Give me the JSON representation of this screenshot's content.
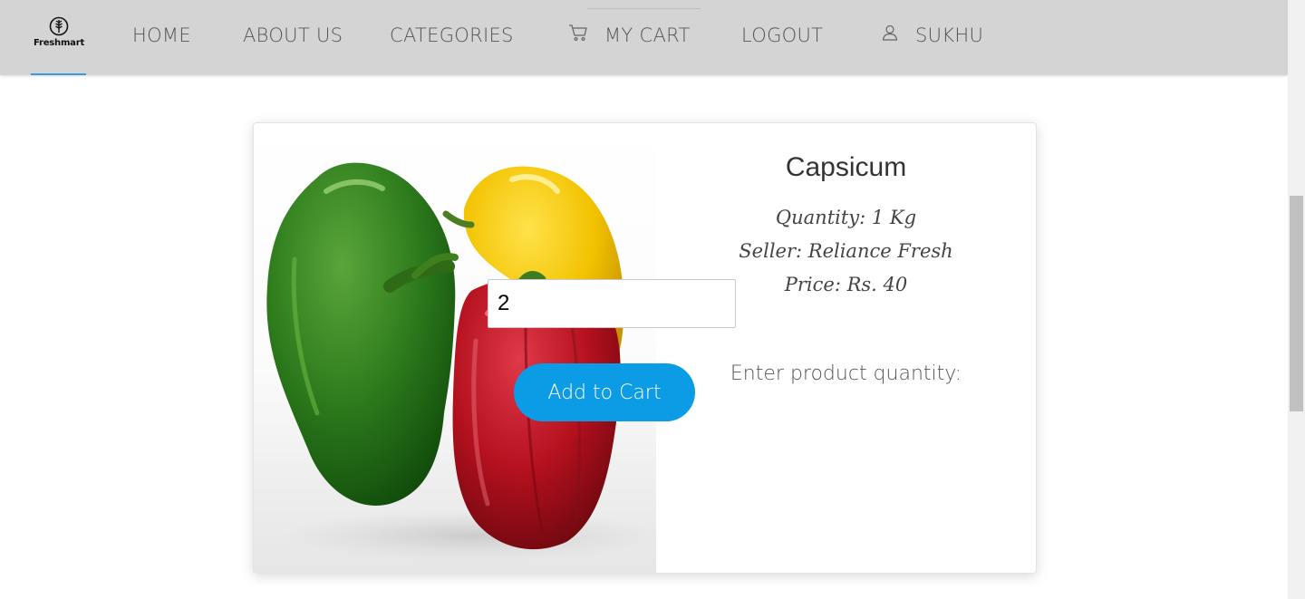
{
  "brand": {
    "name": "Freshmart",
    "accent_color": "#3a9bdc"
  },
  "nav": {
    "home": "HOME",
    "about": "ABOUT US",
    "categories": "CATEGORIES",
    "cart": "MY CART",
    "cart_icon": "cart-icon",
    "logout": "LOGOUT",
    "user": "SUKHU",
    "user_icon": "user-icon"
  },
  "product": {
    "name": "Capsicum",
    "image": "bell-peppers-photo",
    "quantity_line": "Quantity:  1 Kg",
    "seller_line": "Seller:  Reliance Fresh",
    "price_line": "Price:  Rs. 40"
  },
  "order": {
    "quantity_label": "Enter product quantity:",
    "quantity_value": "2",
    "add_button": "Add to Cart",
    "button_color": "#0c9be5"
  }
}
